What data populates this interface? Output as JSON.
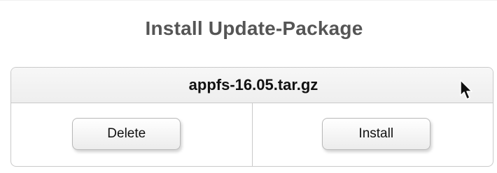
{
  "page": {
    "title": "Install Update-Package"
  },
  "package": {
    "name": "appfs-16.05.tar.gz"
  },
  "actions": {
    "delete_label": "Delete",
    "install_label": "Install"
  },
  "cursor": {
    "icon": "arrow-cursor-icon"
  },
  "colors": {
    "title_text": "#555555",
    "border": "#c9c9c9",
    "header_bg": "#eeeeee"
  }
}
